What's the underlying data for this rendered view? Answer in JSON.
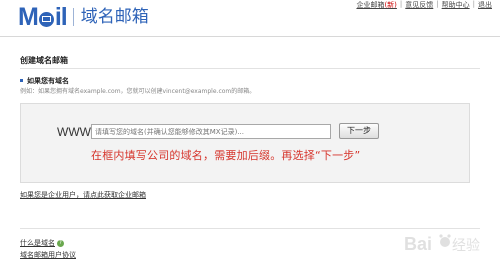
{
  "header": {
    "logo_text": "域名邮箱",
    "links": [
      {
        "label": "企业邮箱",
        "suffix": "(新)"
      },
      {
        "label": "意见反馈"
      },
      {
        "label": "帮助中心"
      },
      {
        "label": "退出"
      }
    ]
  },
  "main": {
    "page_title": "创建域名邮箱",
    "section_title": "如果您有域名",
    "section_desc": "例如：如果您拥有域名example.com，您就可以创建vincent@example.com的邮箱。",
    "www_label": "WWW.",
    "domain_input": {
      "placeholder": "请填写您的域名(并确认您能够修改其MX记录)..."
    },
    "next_button": "下一步",
    "annotation": "在框内填写公司的域名，需要加后缀。再选择“下一步”",
    "enterprise_link": "如果您是企业用户，请点此获取企业邮箱"
  },
  "footer": {
    "faq_link": "什么是域名",
    "help_icon_glyph": "?",
    "agreement_link": "域名邮箱用户协议"
  },
  "colors": {
    "brand": "#2e63b8",
    "annotation": "#d6352c"
  }
}
